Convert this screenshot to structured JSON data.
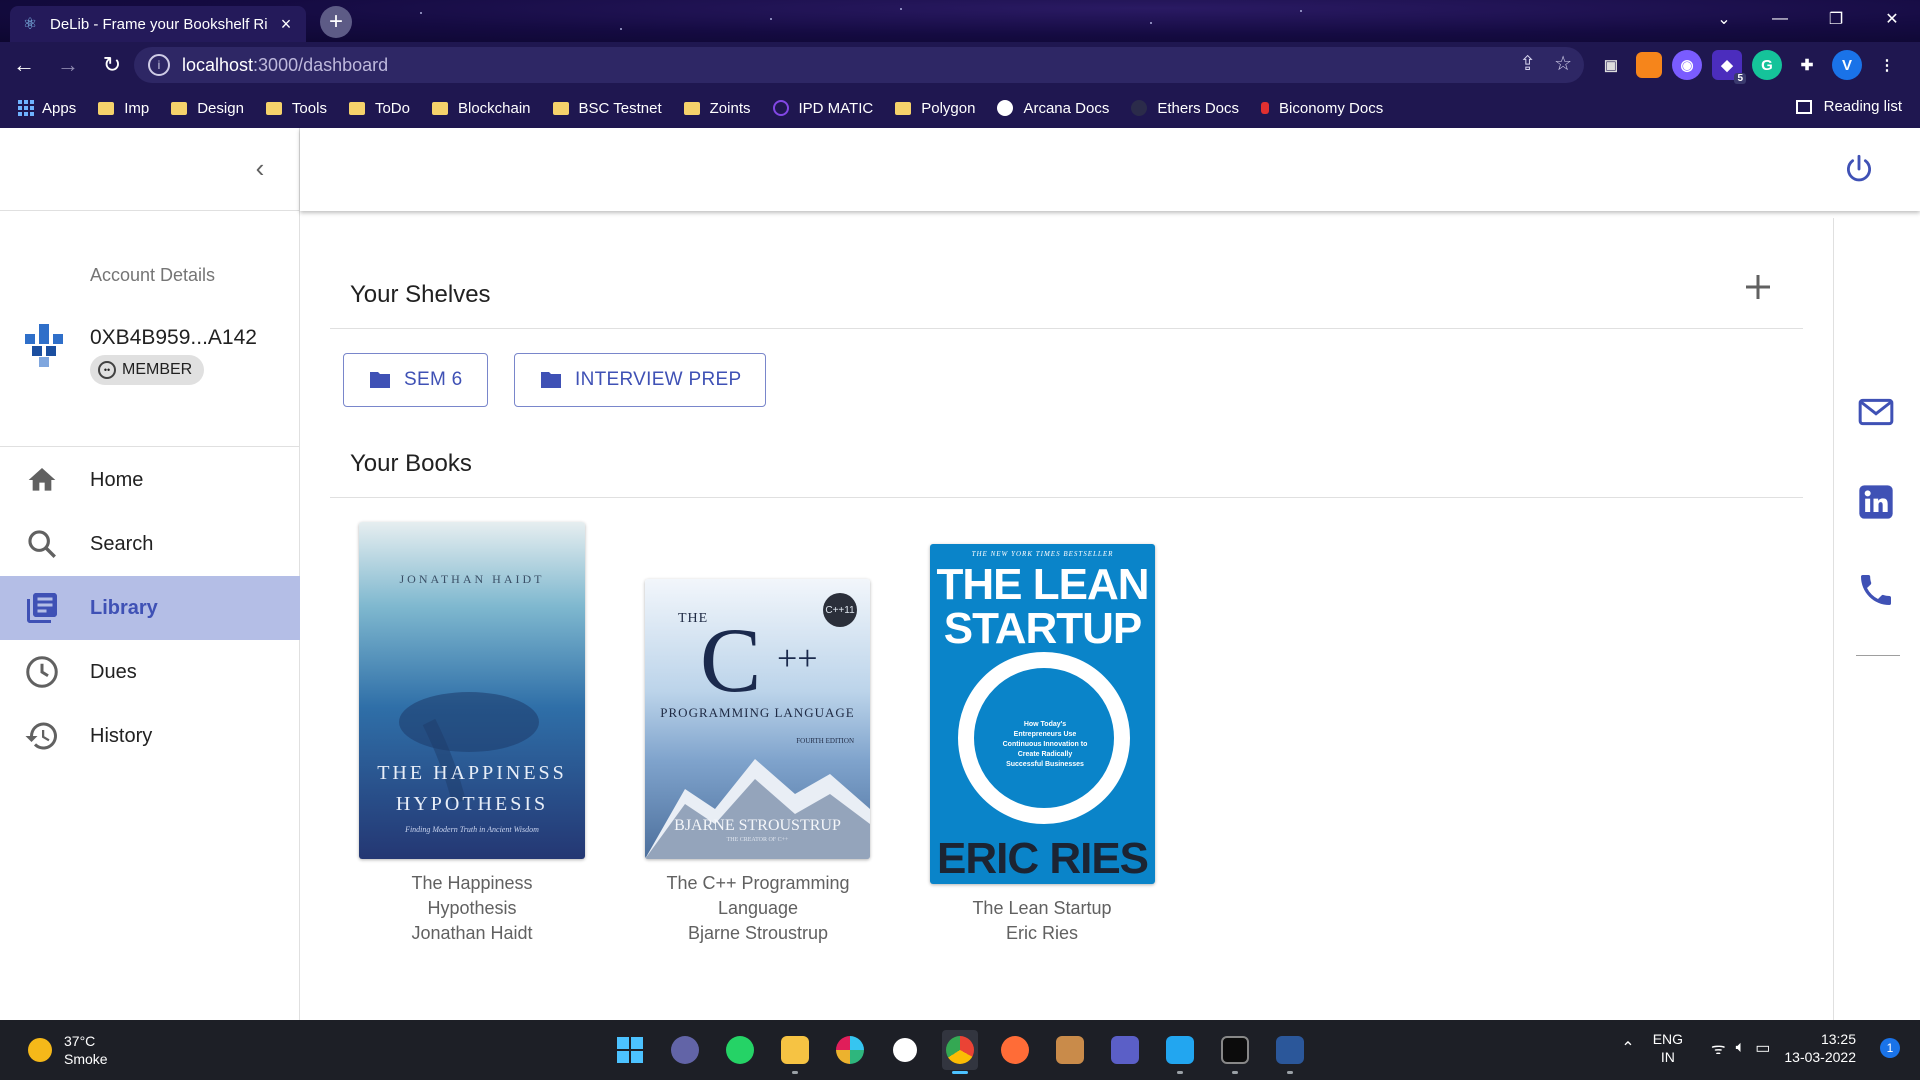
{
  "browser": {
    "tab_title": "DeLib - Frame your Bookshelf Ri",
    "url_host": "localhost",
    "url_path": ":3000/dashboard",
    "bookmarks": [
      {
        "label": "Apps",
        "icon": "apps-grid-icon"
      },
      {
        "label": "Imp",
        "icon": "folder-icon"
      },
      {
        "label": "Design",
        "icon": "folder-icon"
      },
      {
        "label": "Tools",
        "icon": "folder-icon"
      },
      {
        "label": "ToDo",
        "icon": "folder-icon"
      },
      {
        "label": "Blockchain",
        "icon": "folder-icon"
      },
      {
        "label": "BSC Testnet",
        "icon": "folder-icon"
      },
      {
        "label": "Zoints",
        "icon": "folder-icon"
      },
      {
        "label": "IPD MATIC",
        "icon": "polygon-icon"
      },
      {
        "label": "Polygon",
        "icon": "folder-icon"
      },
      {
        "label": "Arcana Docs",
        "icon": "globe-icon"
      },
      {
        "label": "Ethers Docs",
        "icon": "ethers-icon"
      },
      {
        "label": "Biconomy Docs",
        "icon": "biconomy-icon"
      }
    ],
    "reading_list": "Reading list",
    "profile_initial": "V",
    "ext_badge": "5"
  },
  "sidebar": {
    "account_label": "Account Details",
    "account_id": "0XB4B959...A142",
    "role": "MEMBER",
    "nav": [
      {
        "label": "Home",
        "icon": "home-icon"
      },
      {
        "label": "Search",
        "icon": "search-icon"
      },
      {
        "label": "Library",
        "icon": "library-icon",
        "active": true
      },
      {
        "label": "Dues",
        "icon": "clock-icon"
      },
      {
        "label": "History",
        "icon": "history-icon"
      }
    ]
  },
  "main": {
    "shelves_title": "Your Shelves",
    "shelves": [
      "SEM 6",
      "INTERVIEW PREP"
    ],
    "books_title": "Your Books",
    "books": [
      {
        "title_line1": "The Happiness",
        "title_line2": "Hypothesis",
        "author": "Jonathan Haidt",
        "cover": {
          "author": "JONATHAN HAIDT",
          "line1": "THE HAPPINESS",
          "line2": "HYPOTHESIS",
          "tagline": "Finding Modern Truth in Ancient Wisdom"
        }
      },
      {
        "title_line1": "The C++ Programming",
        "title_line2": "Language",
        "author": "Bjarne Stroustrup",
        "cover": {
          "the": "THE",
          "big": "C",
          "plus": "++",
          "badge": "C++11",
          "sub": "PROGRAMMING LANGUAGE",
          "edition": "FOURTH EDITION",
          "author": "BJARNE STROUSTRUP",
          "creator": "THE CREATOR OF C++"
        }
      },
      {
        "title_line1": "The Lean Startup",
        "author": "Eric Ries",
        "cover": {
          "banner": "THE NEW YORK TIMES BESTSELLER",
          "line1": "THE LEAN",
          "line2": "STARTUP",
          "blurb": "How Today's Entrepreneurs Use Continuous Innovation to Create Radically Successful Businesses",
          "author": "ERIC RIES"
        }
      }
    ]
  },
  "taskbar": {
    "temp": "37°C",
    "weather": "Smoke",
    "lang1": "ENG",
    "lang2": "IN",
    "time": "13:25",
    "date": "13-03-2022",
    "notifications": "1"
  },
  "colors": {
    "accent": "#3f51b5",
    "active_bg": "#b4bee6",
    "chrome_bg": "#1f1750"
  }
}
